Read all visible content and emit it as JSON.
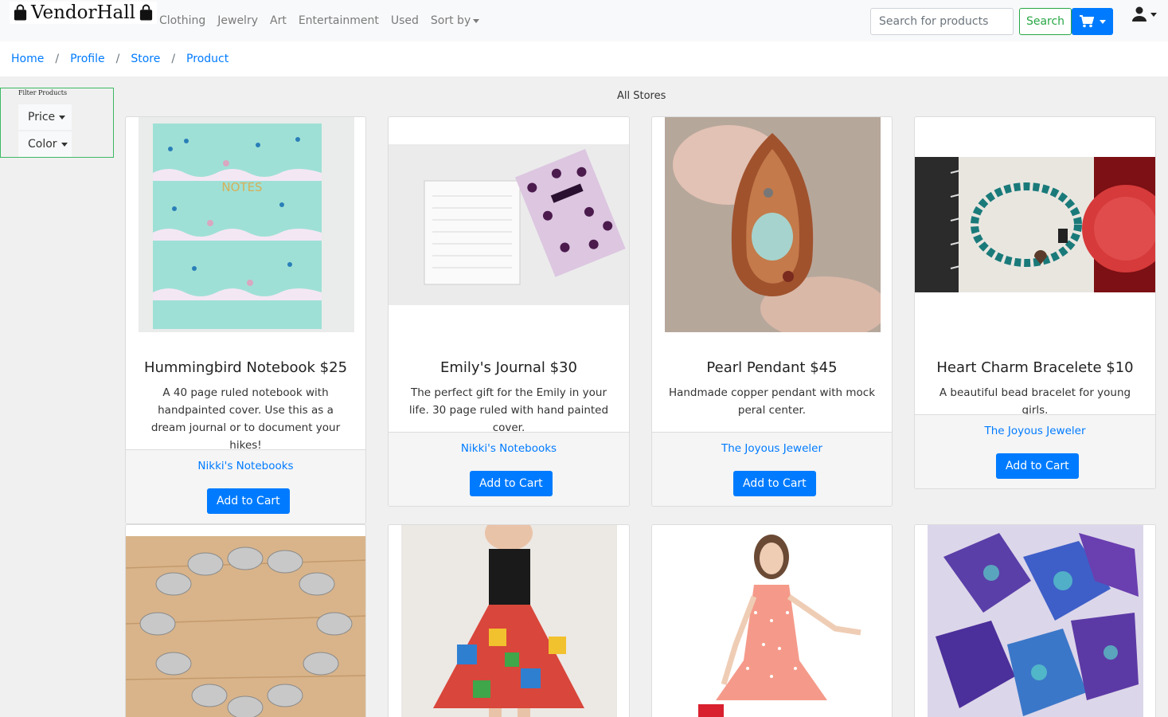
{
  "brand": {
    "name": "VendorHall"
  },
  "nav": {
    "links": [
      "Clothing",
      "Jewelry",
      "Art",
      "Entertainment",
      "Used"
    ],
    "sort_label": "Sort by"
  },
  "search": {
    "placeholder": "Search for products",
    "button_label": "Search"
  },
  "breadcrumb": [
    "Home",
    "Profile",
    "Store",
    "Product"
  ],
  "filter": {
    "title": "Filter Products",
    "price_label": "Price",
    "color_label": "Color"
  },
  "heading": "All Stores",
  "products": [
    {
      "title": "Hummingbird Notebook $25",
      "description": "A 40 page ruled notebook with handpainted cover. Use this as a dream journal or to document your hikes!",
      "store": "Nikki's Notebooks",
      "button": "Add to Cart",
      "image": "mint-notebook-with-birds"
    },
    {
      "title": "Emily's Journal $30",
      "description": "The perfect gift for the Emily in your life. 30 page ruled with hand painted cover.",
      "store": "Nikki's Notebooks",
      "button": "Add to Cart",
      "image": "purple-floral-journal"
    },
    {
      "title": "Pearl Pendant $45",
      "description": "Handmade copper pendant with mock peral center.",
      "store": "The Joyous Jeweler",
      "button": "Add to Cart",
      "image": "copper-wire-pendant"
    },
    {
      "title": "Heart Charm Bracelete $10",
      "description": "A beautiful bead bracelet for young girls.",
      "store": "The Joyous Jeweler",
      "button": "Add to Cart",
      "image": "bead-bracelet"
    },
    {
      "image": "silver-shell-necklace"
    },
    {
      "image": "printed-skirt-outfit"
    },
    {
      "image": "pink-polka-dress"
    },
    {
      "image": "purple-resin-dice"
    }
  ],
  "colors": {
    "primary": "#007bff",
    "success": "#28a745",
    "filter_border": "#3cb964"
  }
}
